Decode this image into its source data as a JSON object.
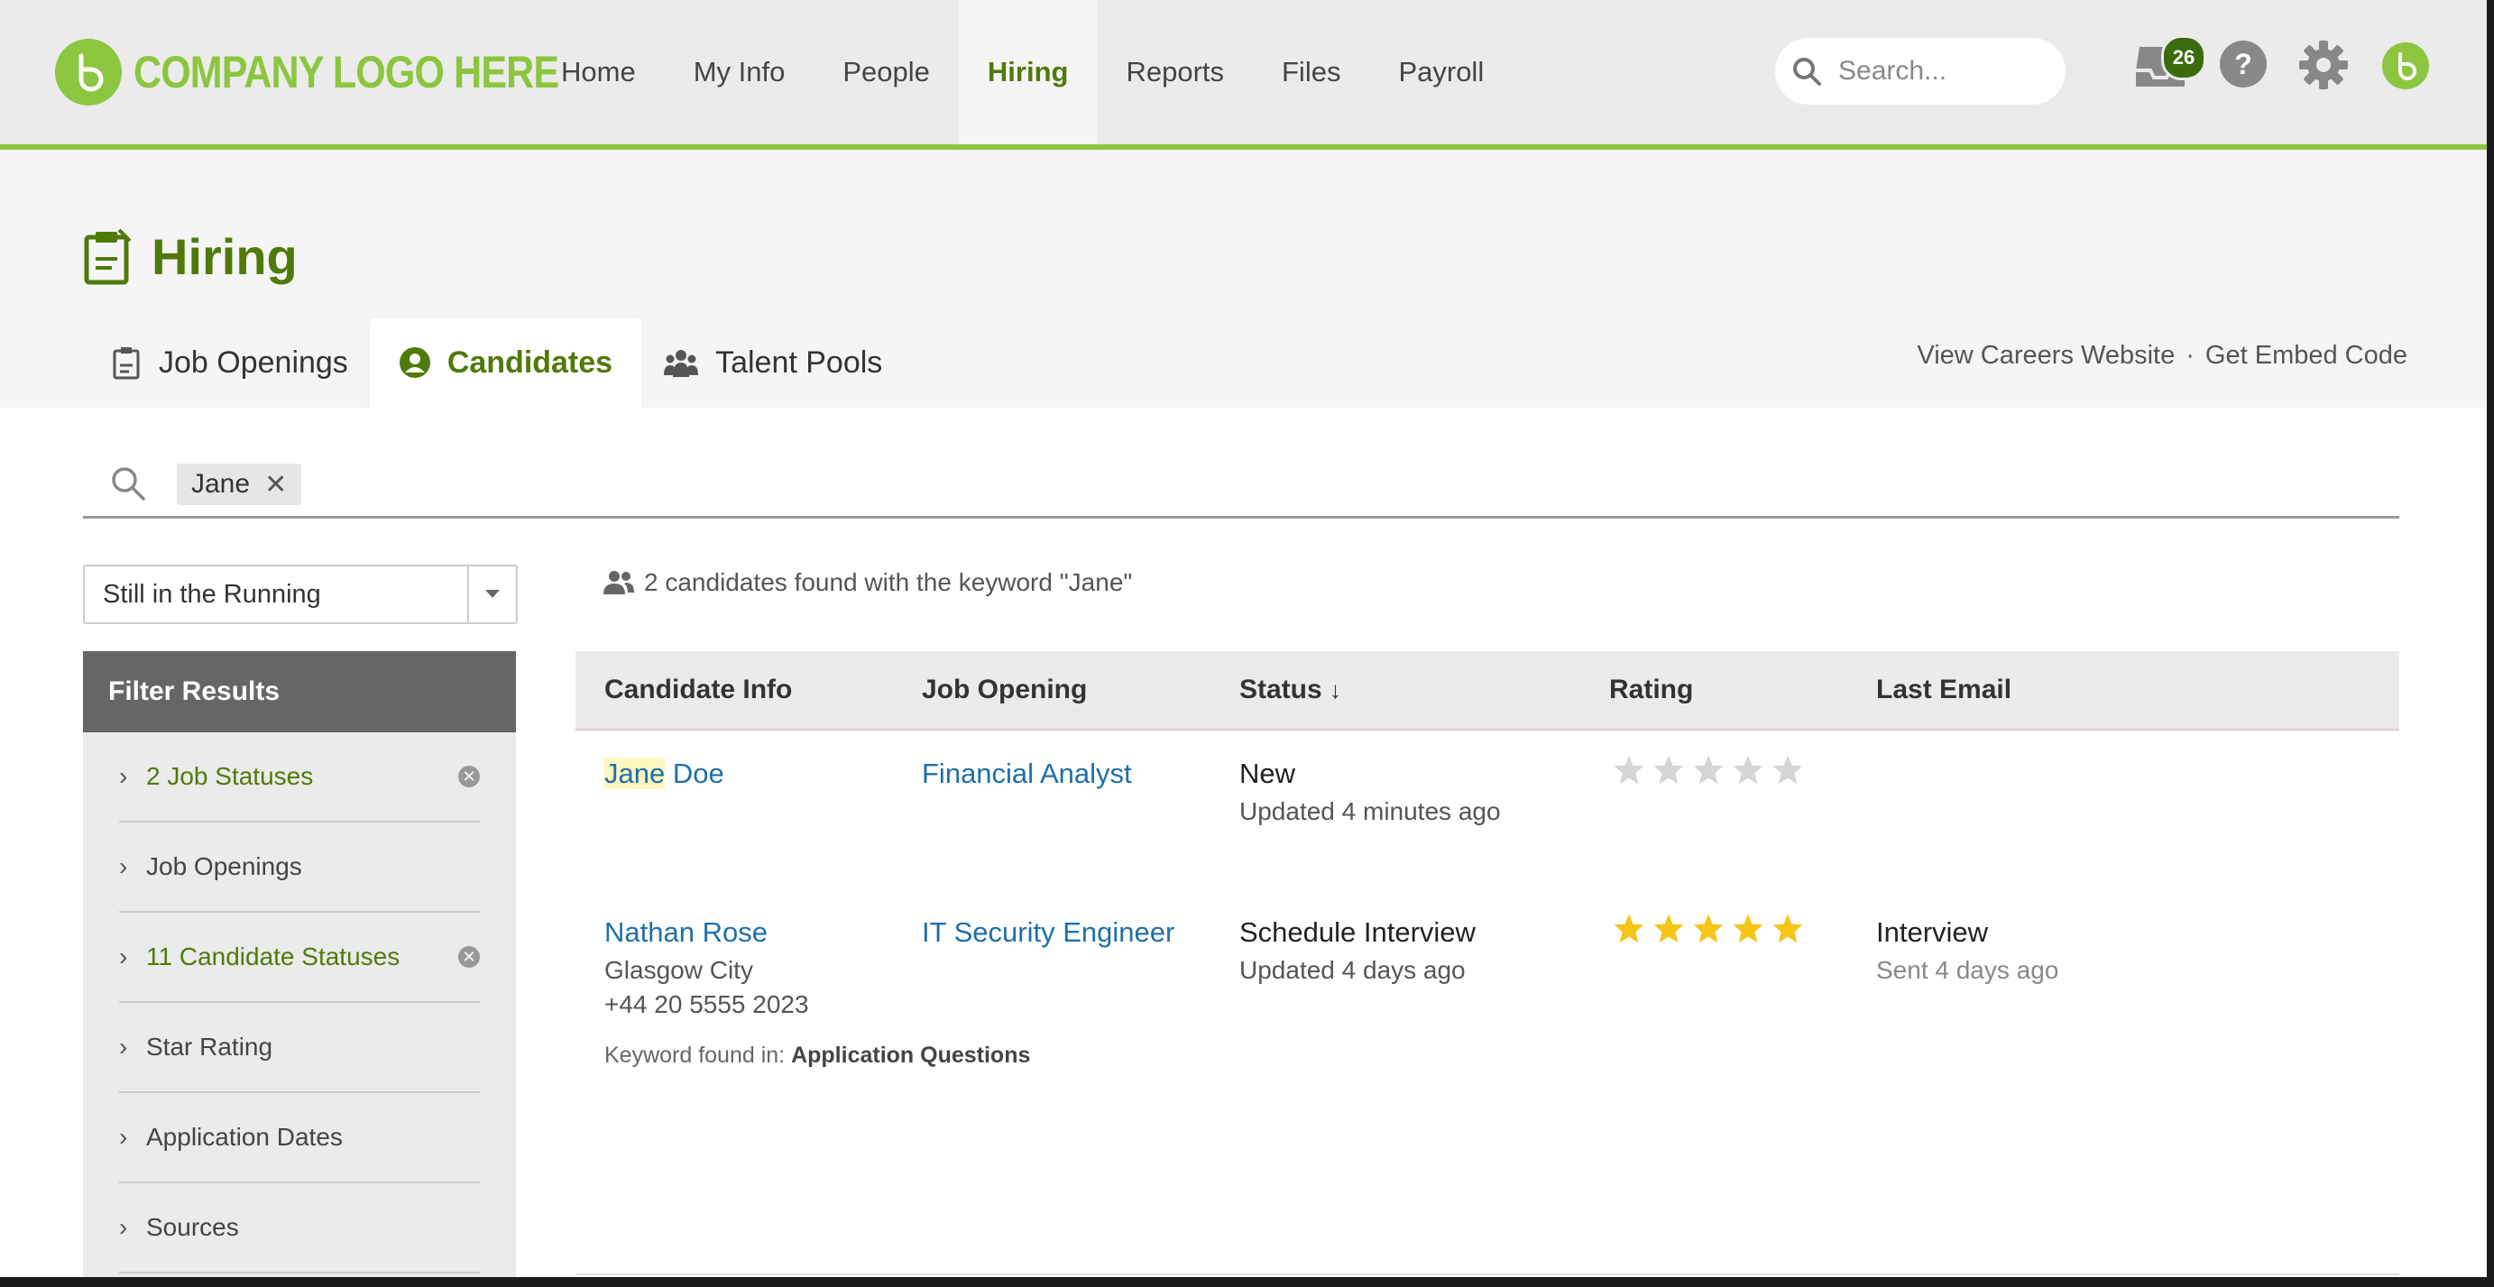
{
  "brand": {
    "logo_text": "COMPANY LOGO HERE",
    "accent": "#8cc63f",
    "accent_dark": "#4f7a09"
  },
  "nav": {
    "items": [
      {
        "label": "Home"
      },
      {
        "label": "My Info"
      },
      {
        "label": "People"
      },
      {
        "label": "Hiring",
        "active": true
      },
      {
        "label": "Reports"
      },
      {
        "label": "Files"
      },
      {
        "label": "Payroll"
      }
    ],
    "search_placeholder": "Search...",
    "inbox_count": "26",
    "icons": [
      "inbox-icon",
      "help-icon",
      "gear-icon",
      "avatar"
    ]
  },
  "page": {
    "title": "Hiring",
    "tabs": [
      {
        "label": "Job Openings",
        "icon": "clipboard-icon"
      },
      {
        "label": "Candidates",
        "icon": "user-circle-icon",
        "active": true
      },
      {
        "label": "Talent Pools",
        "icon": "group-icon"
      }
    ],
    "header_links": {
      "careers": "View Careers Website",
      "separator": "·",
      "embed": "Get Embed Code"
    }
  },
  "keyword_search": {
    "chip": "Jane",
    "chip_remove": "✕"
  },
  "status_filter": {
    "selected": "Still in the Running"
  },
  "filters": {
    "title": "Filter Results",
    "items": [
      {
        "label": "2 Job Statuses",
        "active": true
      },
      {
        "label": "Job Openings",
        "active": false
      },
      {
        "label": "11 Candidate Statuses",
        "active": true
      },
      {
        "label": "Star Rating",
        "active": false
      },
      {
        "label": "Application Dates",
        "active": false
      },
      {
        "label": "Sources",
        "active": false
      }
    ]
  },
  "results": {
    "summary": "2 candidates found with the keyword \"Jane\""
  },
  "table": {
    "headers": {
      "candidate": "Candidate Info",
      "job": "Job Opening",
      "status": "Status",
      "status_sort": "↓",
      "rating": "Rating",
      "last_email": "Last Email"
    },
    "rows": [
      {
        "name_highlight": "Jane",
        "name_rest": " Doe",
        "location": "",
        "phone": "",
        "job": "Financial Analyst",
        "status": "New",
        "status_updated": "Updated 4 minutes ago",
        "rating": 0,
        "rating_max": 5,
        "email": "",
        "email_sent": "",
        "keyword_prefix": "",
        "keyword_field": ""
      },
      {
        "name_highlight": "",
        "name_rest": "Nathan Rose",
        "location": "Glasgow City",
        "phone": "+44 20 5555 2023",
        "job": "IT Security Engineer",
        "status": "Schedule Interview",
        "status_updated": "Updated 4 days ago",
        "rating": 5,
        "rating_max": 5,
        "email": "Interview",
        "email_sent": "Sent 4 days ago",
        "keyword_prefix": "Keyword found in: ",
        "keyword_field": "Application Questions"
      }
    ]
  },
  "colors": {
    "star_on": "#f5c518",
    "star_off": "#d6d6d6",
    "link": "#1f6fa8"
  }
}
